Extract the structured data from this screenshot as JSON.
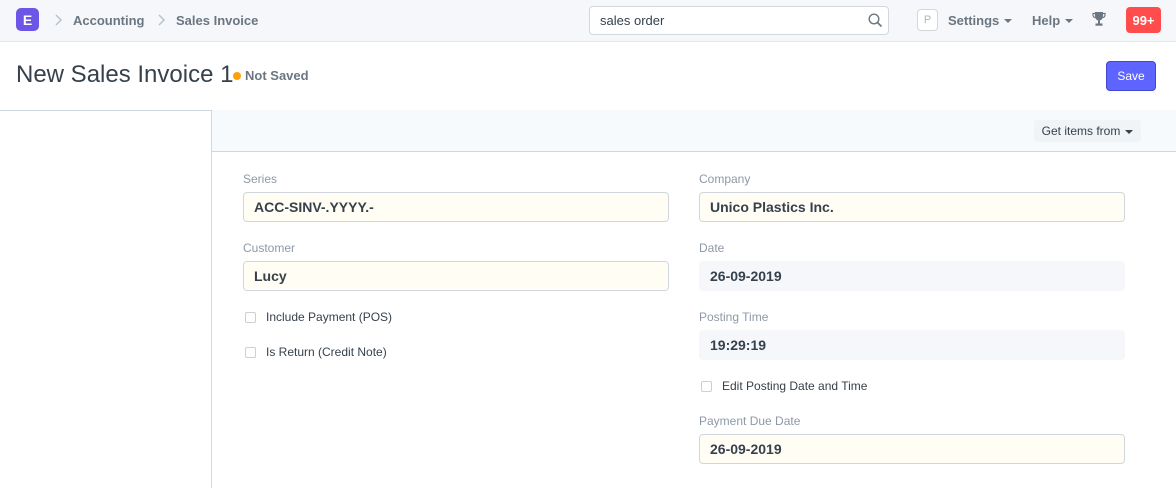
{
  "navbar": {
    "logo": "E",
    "breadcrumbs": [
      "Accounting",
      "Sales Invoice"
    ],
    "search": {
      "value": "sales order"
    },
    "avatar_initial": "P",
    "settings_label": "Settings",
    "help_label": "Help",
    "notifications_count": "99+"
  },
  "page": {
    "title": "New Sales Invoice 1",
    "status": "Not Saved",
    "status_color": "#ffa00a",
    "save_label": "Save"
  },
  "toolbar": {
    "get_items_label": "Get items from"
  },
  "form": {
    "left": {
      "series": {
        "label": "Series",
        "value": "ACC-SINV-.YYYY.-"
      },
      "customer": {
        "label": "Customer",
        "value": "Lucy"
      },
      "include_payment": {
        "label": "Include Payment (POS)",
        "checked": false
      },
      "is_return": {
        "label": "Is Return (Credit Note)",
        "checked": false
      }
    },
    "right": {
      "company": {
        "label": "Company",
        "value": "Unico Plastics Inc."
      },
      "date": {
        "label": "Date",
        "value": "26-09-2019"
      },
      "posting_time": {
        "label": "Posting Time",
        "value": "19:29:19"
      },
      "edit_posting": {
        "label": "Edit Posting Date and Time",
        "checked": false
      },
      "payment_due_date": {
        "label": "Payment Due Date",
        "value": "26-09-2019"
      }
    }
  },
  "colors": {
    "accent": "#5e64ff",
    "logo": "#6d56e6",
    "badge": "#ff4d4d"
  }
}
